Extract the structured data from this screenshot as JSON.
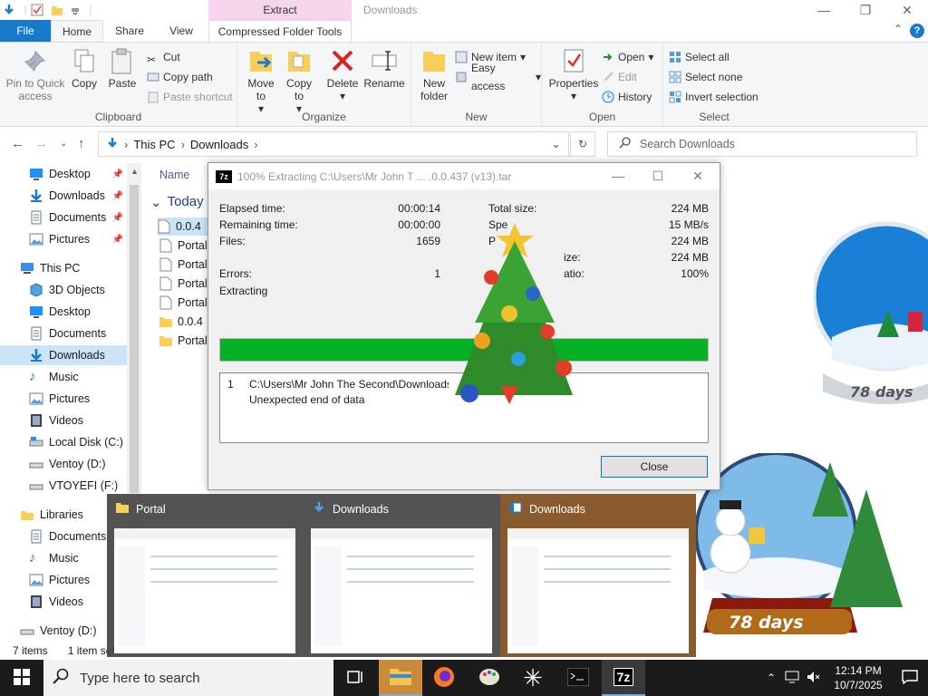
{
  "titlebar": {
    "context_tab": "Extract",
    "window_title": "Downloads",
    "minimize": "—",
    "maximize": "❐",
    "close": "✕"
  },
  "tabs": {
    "file": "File",
    "home": "Home",
    "share": "Share",
    "view": "View",
    "compressed": "Compressed Folder Tools",
    "help": "?"
  },
  "ribbon": {
    "clipboard": {
      "label": "Clipboard",
      "pin": "Pin to Quick access",
      "copy": "Copy",
      "paste": "Paste",
      "cut": "Cut",
      "copy_path": "Copy path",
      "paste_shortcut": "Paste shortcut"
    },
    "organize": {
      "label": "Organize",
      "move_to": "Move to",
      "copy_to": "Copy to",
      "delete": "Delete",
      "rename": "Rename"
    },
    "new": {
      "label": "New",
      "new_folder": "New folder",
      "new_item": "New item",
      "easy_access": "Easy access"
    },
    "open": {
      "label": "Open",
      "properties": "Properties",
      "open": "Open",
      "edit": "Edit",
      "history": "History"
    },
    "select": {
      "label": "Select",
      "select_all": "Select all",
      "select_none": "Select none",
      "invert": "Invert selection"
    }
  },
  "address": {
    "segments": [
      "This PC",
      "Downloads"
    ],
    "search_placeholder": "Search Downloads"
  },
  "nav": {
    "quick": [
      {
        "label": "Desktop",
        "icon": "desktop-icon"
      },
      {
        "label": "Downloads",
        "icon": "download-icon"
      },
      {
        "label": "Documents",
        "icon": "documents-icon"
      },
      {
        "label": "Pictures",
        "icon": "pictures-icon"
      }
    ],
    "this_pc": "This PC",
    "pc_items": [
      {
        "label": "3D Objects"
      },
      {
        "label": "Desktop"
      },
      {
        "label": "Documents"
      },
      {
        "label": "Downloads"
      },
      {
        "label": "Music"
      },
      {
        "label": "Pictures"
      },
      {
        "label": "Videos"
      },
      {
        "label": "Local Disk (C:)"
      },
      {
        "label": "Ventoy (D:)"
      },
      {
        "label": "VTOYEFI (F:)"
      }
    ],
    "libraries": "Libraries",
    "lib_items": [
      {
        "label": "Documents"
      },
      {
        "label": "Music"
      },
      {
        "label": "Pictures"
      },
      {
        "label": "Videos"
      }
    ],
    "ventoy_bottom": "Ventoy (D:)"
  },
  "filelist": {
    "name_header": "Name",
    "group": "Today (",
    "rows": [
      "0.0.4",
      "Portal",
      "Portal",
      "Portal",
      "Portal",
      "0.0.4",
      "Portal"
    ]
  },
  "status": {
    "items": "7 items",
    "selected": "1 item sel"
  },
  "dialog": {
    "title": "100% Extracting C:\\Users\\Mr John T ... .0.0.437 (v13).tar",
    "elapsed_label": "Elapsed time:",
    "elapsed": "00:00:14",
    "remaining_label": "Remaining time:",
    "remaining": "00:00:00",
    "files_label": "Files:",
    "files": "1659",
    "errors_label": "Errors:",
    "errors": "1",
    "status": "Extracting",
    "total_label": "Total size:",
    "total": "224 MB",
    "speed_label": "Spe",
    "speed": "15 MB/s",
    "processed_label": "P",
    "processed": "224 MB",
    "packed_label": "ize:",
    "packed": "224 MB",
    "ratio_label": "atio:",
    "ratio": "100%",
    "progress": 1.0,
    "log_num": "1",
    "log_path": "C:\\Users\\Mr John The Second\\Downloads\\0.0",
    "log_msg": "Unexpected end of data",
    "close": "Close"
  },
  "thumbs": [
    {
      "title": "Portal"
    },
    {
      "title": "Downloads"
    },
    {
      "title": "Downloads"
    }
  ],
  "decor": {
    "globe_days": "78 days"
  },
  "taskbar": {
    "search_placeholder": "Type here to search",
    "time": "12:14 PM",
    "date": "10/7/2025",
    "z7": "7z"
  }
}
